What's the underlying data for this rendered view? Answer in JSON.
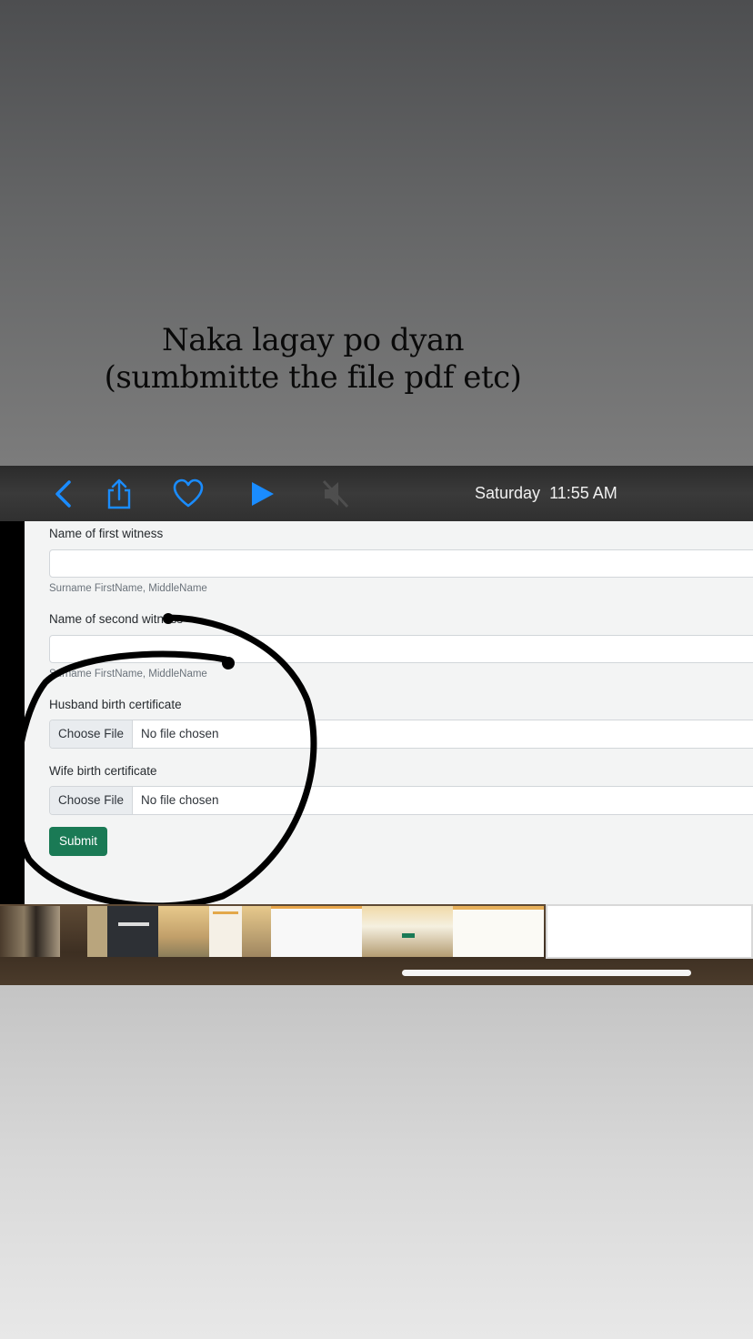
{
  "caption": {
    "line1": "Naka lagay po dyan",
    "line2": "(sumbmitte the file pdf etc)"
  },
  "toolbar": {
    "icons": [
      "back-chevron-icon",
      "share-icon",
      "heart-icon",
      "play-icon",
      "mute-icon"
    ],
    "accent_color": "#1a8cff",
    "day": "Saturday",
    "time": "11:55 AM"
  },
  "form": {
    "first_witness": {
      "label": "Name of first witness",
      "value": "",
      "help": "Surname FirstName, MiddleName"
    },
    "second_witness": {
      "label": "Name of second witness",
      "value": "",
      "help": "Surname FirstName, MiddleName"
    },
    "husband_cert": {
      "label": "Husband birth certificate",
      "button": "Choose File",
      "status": "No file chosen"
    },
    "wife_cert": {
      "label": "Wife birth certificate",
      "button": "Choose File",
      "status": "No file chosen"
    },
    "submit_label": "Submit",
    "submit_color": "#1a7a55"
  }
}
